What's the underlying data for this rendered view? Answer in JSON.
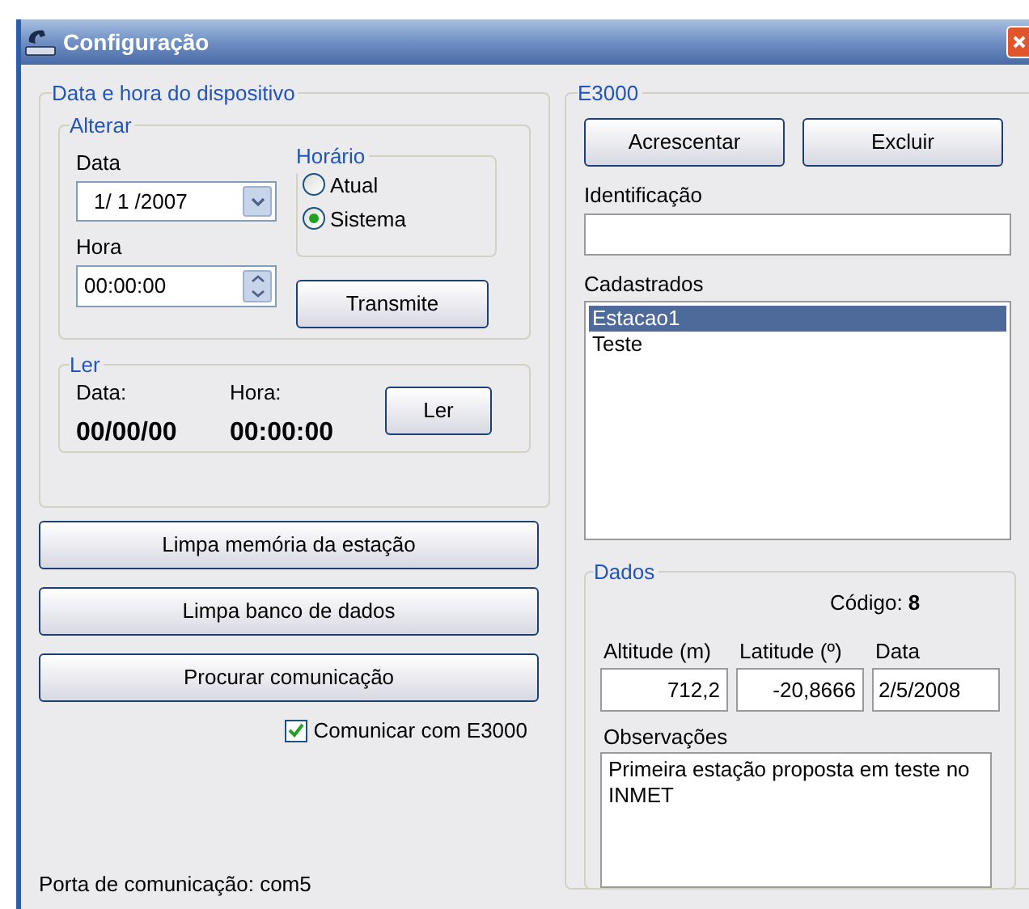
{
  "window": {
    "title": "Configuração"
  },
  "device_datetime": {
    "title": "Data e hora do dispositivo",
    "alterar": {
      "title": "Alterar",
      "date_label": "Data",
      "date_value": "1/ 1 /2007",
      "time_label": "Hora",
      "time_value": "00:00:00",
      "horario": {
        "title": "Horário",
        "options": [
          {
            "label": "Atual",
            "selected": false
          },
          {
            "label": "Sistema",
            "selected": true
          }
        ]
      },
      "transmit_button": "Transmite"
    },
    "ler": {
      "title": "Ler",
      "date_label": "Data:",
      "date_value": "00/00/00",
      "time_label": "Hora:",
      "time_value": "00:00:00",
      "button": "Ler"
    }
  },
  "actions": [
    "Limpa memória da estação",
    "Limpa banco de dados",
    "Procurar comunicação"
  ],
  "communicate": {
    "label": "Comunicar com E3000",
    "checked": true
  },
  "status": "Porta de comunicação: com5",
  "e3000": {
    "title": "E3000",
    "buttons": [
      "Acrescentar",
      "Excluir"
    ],
    "identification_label": "Identificação",
    "registered_label": "Cadastrados",
    "stations": [
      {
        "name": "Estacao1",
        "selected": true
      },
      {
        "name": "Teste",
        "selected": false
      }
    ],
    "dados": {
      "title": "Dados",
      "code": "Código: **8**",
      "altitude_label": "Altitude (m)",
      "altitude": "712,2",
      "latitude_label": "Latitude (º)",
      "latitude": "-20,8666",
      "date_label": "Data",
      "date": "2/5/2008",
      "notes_label": "Observações",
      "notes": "Primeira estação proposta em teste no INMET"
    }
  }
}
